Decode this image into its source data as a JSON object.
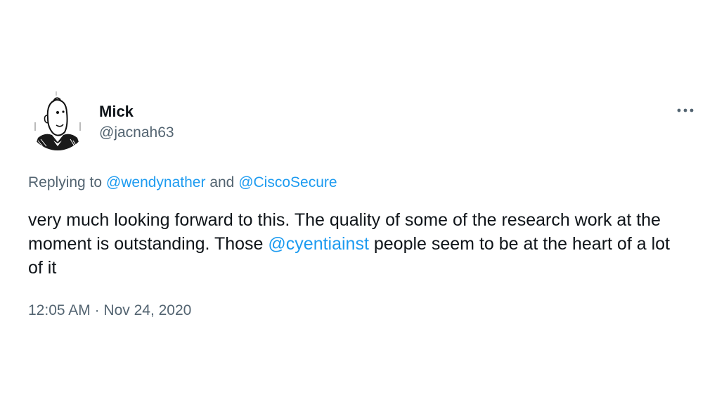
{
  "author": {
    "display_name": "Mick",
    "handle": "@jacnah63"
  },
  "reply": {
    "prefix": "Replying to ",
    "mention_1": "@wendynather",
    "conjunction": " and ",
    "mention_2": "@CiscoSecure"
  },
  "tweet": {
    "text_part_1": "very much looking forward to this. The quality of some of the research work at the moment is outstanding. Those ",
    "mention": "@cyentiainst",
    "text_part_2": " people seem to be at the heart of a lot of it"
  },
  "timestamp": {
    "time": "12:05 AM",
    "separator": " · ",
    "date": "Nov 24, 2020"
  },
  "icons": {
    "more": "more-horizontal-icon",
    "avatar": "caricature-avatar"
  },
  "colors": {
    "link": "#1d9bf0",
    "secondary_text": "#536471",
    "primary_text": "#0f1419"
  }
}
